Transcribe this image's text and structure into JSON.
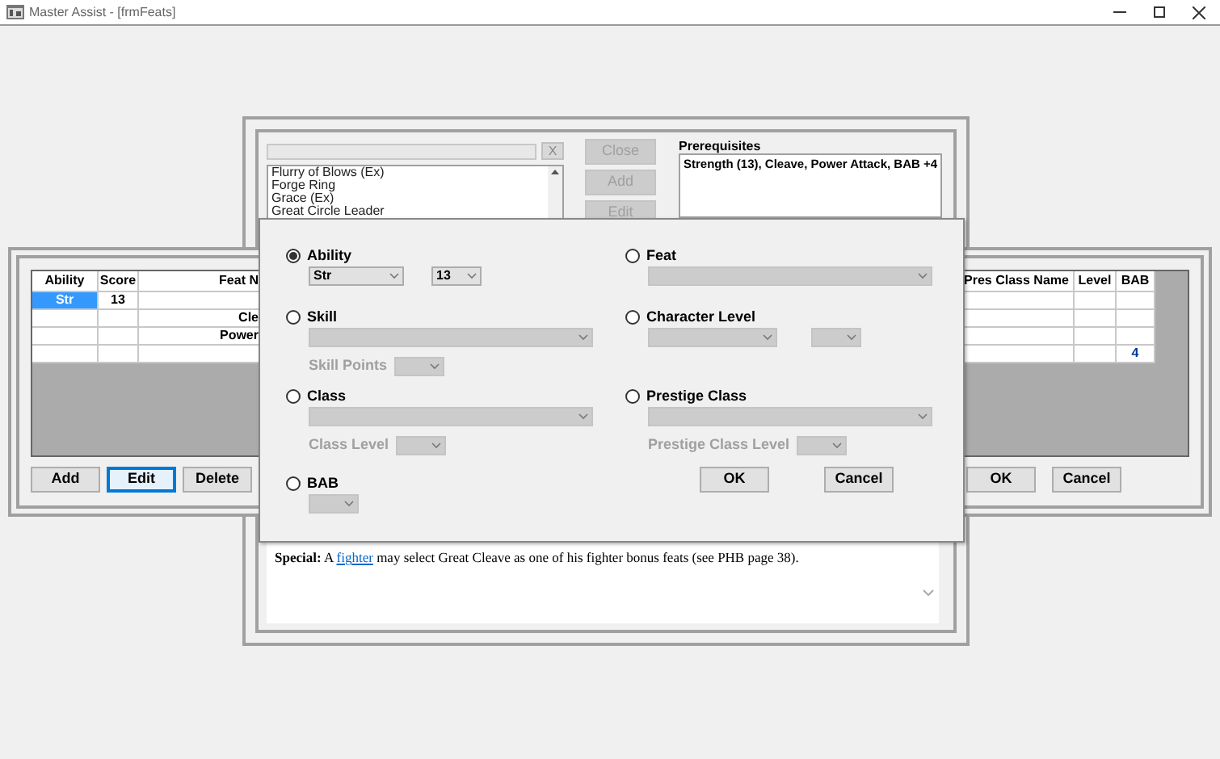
{
  "window": {
    "title": "Master Assist - [frmFeats]"
  },
  "feat_window": {
    "clear_button": "X",
    "feat_list": [
      {
        "label": "Flurry of Blows (Ex)",
        "selected": false
      },
      {
        "label": "Forge Ring",
        "selected": false
      },
      {
        "label": "Grace (Ex)",
        "selected": false
      },
      {
        "label": "Great Circle Leader",
        "selected": false
      }
    ],
    "buttons": [
      {
        "label": "Close",
        "disabled": true
      },
      {
        "label": "Add",
        "disabled": true
      },
      {
        "label": "Edit",
        "disabled": true
      }
    ],
    "prerequisites": {
      "label": "Prerequisites",
      "value": "Strength (13), Cleave, Power Attack, BAB +4"
    },
    "special": {
      "lead": "Special:",
      "before": " A ",
      "link": "fighter",
      "after": " may select Great Cleave as one of his fighter bonus feats (see PHB page 38)."
    }
  },
  "prereq_window": {
    "columns_left": [
      "Ability",
      "Score",
      "Feat N"
    ],
    "columns_right": [
      "Pres Class Name",
      "Level",
      "BAB"
    ],
    "rows": [
      {
        "selected": true,
        "ability": "Str",
        "score": "13"
      },
      {
        "selected": false,
        "feat": "Cle"
      },
      {
        "selected": false,
        "feat": "Power"
      },
      {
        "selected": false,
        "bab": "4"
      }
    ],
    "buttons_left": [
      {
        "label": "Add",
        "focused": false
      },
      {
        "label": "Edit",
        "focused": true
      },
      {
        "label": "Delete",
        "focused": false
      }
    ],
    "buttons_right": [
      {
        "label": "OK",
        "focused": false
      },
      {
        "label": "Cancel",
        "focused": false
      }
    ]
  },
  "dialog": {
    "left_options": [
      {
        "label": "Ability",
        "selected": true,
        "dropdowns": [
          {
            "kind": "medium",
            "disabled": false,
            "value": "Str"
          },
          {
            "kind": "small",
            "disabled": false,
            "value": "13"
          }
        ]
      },
      {
        "label": "Skill",
        "selected": false,
        "dropdowns": [
          {
            "kind": "wide",
            "disabled": true
          }
        ],
        "sub": {
          "label": "Skill Points",
          "dropdown": {
            "kind": "small",
            "disabled": true
          }
        }
      },
      {
        "label": "Class",
        "selected": false,
        "dropdowns": [
          {
            "kind": "wide",
            "disabled": true
          }
        ],
        "sub": {
          "label": "Class Level",
          "dropdown": {
            "kind": "small",
            "disabled": true
          }
        }
      },
      {
        "label": "BAB",
        "selected": false,
        "dropdowns": [
          {
            "kind": "small",
            "disabled": true
          }
        ]
      }
    ],
    "right_options": [
      {
        "label": "Feat",
        "selected": false,
        "dropdowns": [
          {
            "kind": "wide",
            "disabled": true
          }
        ]
      },
      {
        "label": "Character Level",
        "selected": false,
        "dropdowns": [
          {
            "kind": "long",
            "disabled": true
          },
          {
            "kind": "small",
            "disabled": true
          }
        ]
      },
      {
        "label": "Prestige Class",
        "selected": false,
        "dropdowns": [
          {
            "kind": "wide",
            "disabled": true
          }
        ],
        "sub": {
          "label": "Prestige Class Level",
          "dropdown": {
            "kind": "small",
            "disabled": true
          }
        }
      }
    ],
    "buttons": [
      "OK",
      "Cancel"
    ]
  }
}
